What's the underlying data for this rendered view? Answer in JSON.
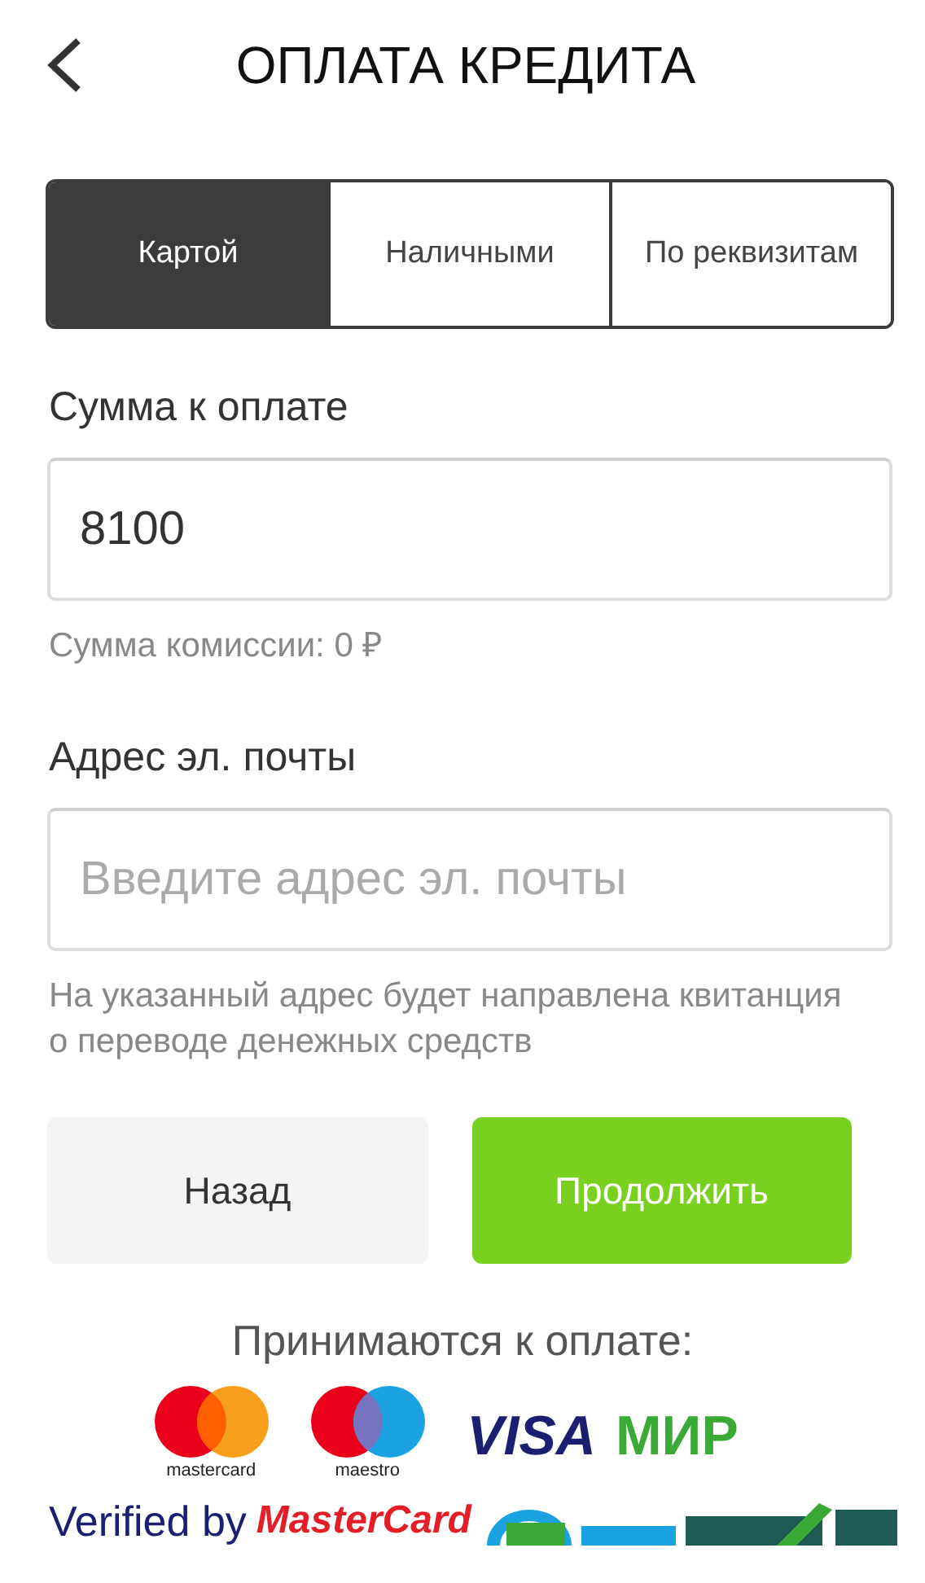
{
  "header": {
    "title": "ОПЛАТА КРЕДИТА"
  },
  "tabs": [
    {
      "label": "Картой",
      "selected": true
    },
    {
      "label": "Наличными",
      "selected": false
    },
    {
      "label": "По реквизитам",
      "selected": false
    }
  ],
  "amount": {
    "label": "Сумма к оплате",
    "value": "8100",
    "hint": "Сумма комиссии: 0 ₽"
  },
  "email": {
    "label": "Адрес эл. почты",
    "placeholder": "Введите адрес эл. почты",
    "hint": "На указанный адрес будет направлена квитанция о переводе денежных средств"
  },
  "buttons": [
    {
      "label": "Назад",
      "kind": "secondary"
    },
    {
      "label": "Продолжить",
      "kind": "primary"
    }
  ],
  "accepted": {
    "title": "Принимаются к оплате:",
    "logos": [
      {
        "kind": "mastercard",
        "text": "mastercard"
      },
      {
        "kind": "maestro",
        "text": "maestro"
      },
      {
        "kind": "visa",
        "text": "VISA"
      },
      {
        "kind": "mir",
        "text": "МИР"
      }
    ]
  },
  "security": {
    "verified": "Verified by",
    "mastercard": "MasterCard"
  }
}
